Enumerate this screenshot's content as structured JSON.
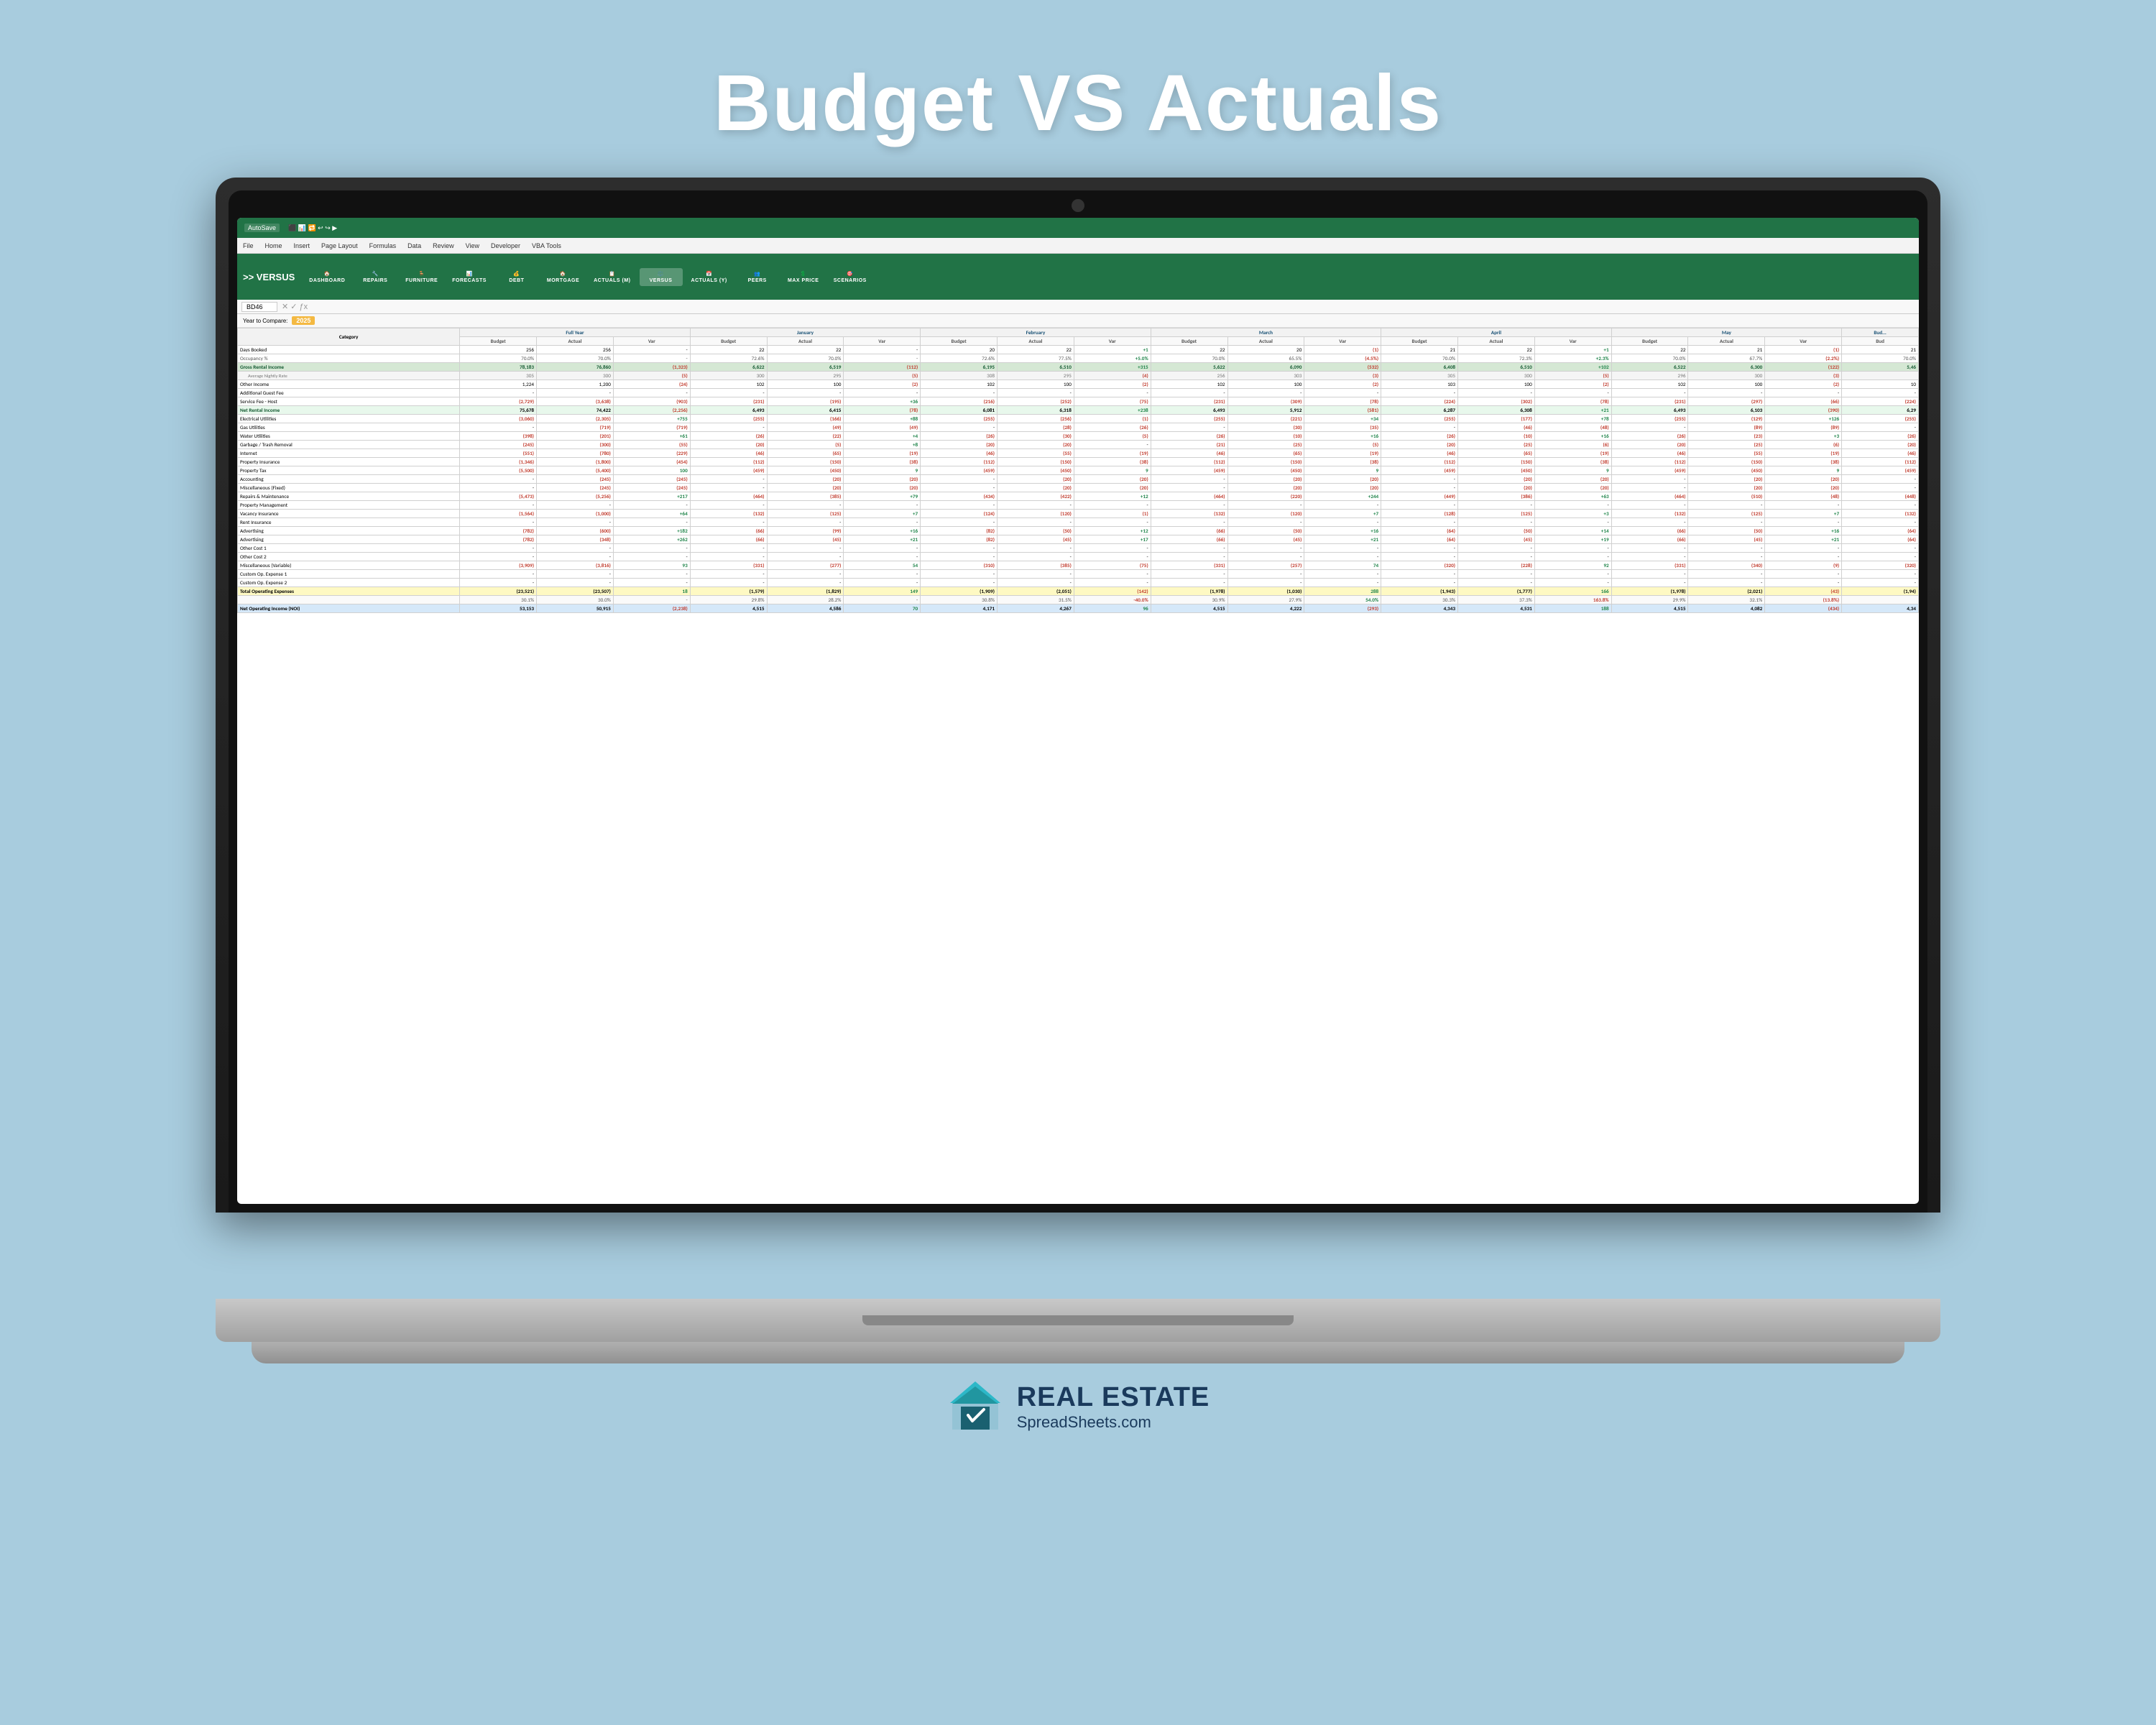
{
  "page": {
    "title": "Budget VS Actuals",
    "background": "#a8ccde"
  },
  "brand": {
    "name": "REAL ESTATE",
    "url": "SpreadSheets.com"
  },
  "excel": {
    "autosave": "AutoSave",
    "cellRef": "BD46",
    "menuItems": [
      "File",
      "Home",
      "Insert",
      "Page Layout",
      "Formulas",
      "Data",
      "Review",
      "View",
      "Developer",
      "VBA Tools"
    ],
    "ribbonButtons": [
      {
        "icon": "🏠",
        "label": "DASHBOARD"
      },
      {
        "icon": "🔧",
        "label": "REPAIRS"
      },
      {
        "icon": "🪑",
        "label": "FURNITURE"
      },
      {
        "icon": "📊",
        "label": "FORECASTS"
      },
      {
        "icon": "💰",
        "label": "DEBT"
      },
      {
        "icon": "🏠",
        "label": "MORTGAGE"
      },
      {
        "icon": "📋",
        "label": "ACTUALS (M)"
      },
      {
        "icon": "⚖️",
        "label": "VERSUS"
      },
      {
        "icon": "📅",
        "label": "ACTUALS (Y)"
      },
      {
        "icon": "👥",
        "label": "PEERS"
      },
      {
        "icon": "💲",
        "label": "MAX PRICE"
      },
      {
        "icon": "🎯",
        "label": "SCENARIOS"
      }
    ],
    "versusLabel": ">> VERSUS",
    "yearCompare": "Year to Compare:",
    "yearTag": "2025"
  },
  "table": {
    "months": [
      "Full Year",
      "January",
      "February",
      "March",
      "April",
      "May"
    ],
    "subHeaders": [
      "Budget",
      "Actual",
      "Var"
    ],
    "rows": [
      {
        "category": "Days Booked",
        "type": "data",
        "values": [
          "256",
          "256",
          "-",
          "22",
          "22",
          "-",
          "20",
          "22",
          "+1",
          "22",
          "20",
          "(1)",
          "21",
          "22",
          "+1",
          "22",
          "21",
          "(1)"
        ]
      },
      {
        "category": "Occupancy %",
        "type": "pct",
        "values": [
          "70.0%",
          "70.0%",
          "-",
          "72.6%",
          "70.0%",
          "-",
          "72.6%",
          "77.5%",
          "+5.0%",
          "70.0%",
          "65.5%",
          "(4.5%)",
          "70.0%",
          "72.3%",
          "+2.3%",
          "70.0%",
          "67.7%",
          "(2.2%)"
        ]
      },
      {
        "category": "Gross Rental Income",
        "type": "section-header",
        "values": [
          "78,183",
          "76,860",
          "(1,323)",
          "6,622",
          "6,519",
          "(112)",
          "6,195",
          "6,510",
          "+315",
          "5,622",
          "6,090",
          "(532)",
          "6,408",
          "6,510",
          "+102",
          "6,522",
          "6,300",
          "(122)"
        ]
      },
      {
        "category": "Average Nightly Rate",
        "type": "rate",
        "values": [
          "305",
          "300",
          "(5)",
          "300",
          "295",
          "(5)",
          "308",
          "295",
          "(4)",
          "256",
          "303",
          "(3)",
          "305",
          "300",
          "(5)",
          "296",
          "300",
          "(3)"
        ]
      },
      {
        "category": "Other Income",
        "type": "data",
        "values": [
          "1,224",
          "1,200",
          "(24)",
          "102",
          "100",
          "(2)",
          "102",
          "100",
          "(2)",
          "102",
          "100",
          "(2)",
          "103",
          "100",
          "(2)",
          "102",
          "100",
          "(2)"
        ]
      },
      {
        "category": "Additional Guest Fee",
        "type": "data",
        "values": [
          "-",
          "-",
          "-",
          "-",
          "-",
          "-",
          "-",
          "-",
          "-",
          "-",
          "-",
          "-",
          "-",
          "-",
          "-",
          "-",
          "-",
          "-"
        ]
      },
      {
        "category": "Service Fee - Host",
        "type": "data",
        "values": [
          "(2,729)",
          "(3,638)",
          "(903)",
          "(231)",
          "(195)",
          "+36",
          "(216)",
          "(252)",
          "(75)",
          "(231)",
          "(309)",
          "(78)",
          "(224)",
          "(302)",
          "(78)",
          "(231)",
          "(297)",
          "(66)"
        ]
      },
      {
        "category": "Net Rental Income",
        "type": "bold-green",
        "values": [
          "75,678",
          "74,422",
          "(2,256)",
          "6,493",
          "6,415",
          "(78)",
          "6,081",
          "6,318",
          "+238",
          "6,493",
          "5,912",
          "(581)",
          "6,287",
          "6,308",
          "+21",
          "6,493",
          "6,103",
          "(390)"
        ]
      },
      {
        "category": "Electrical Utilities",
        "type": "data",
        "values": [
          "(3,060)",
          "(2,305)",
          "+755",
          "(255)",
          "(166)",
          "+88",
          "(255)",
          "(256)",
          "(1)",
          "(255)",
          "(221)",
          "+34",
          "(255)",
          "(177)",
          "+78",
          "(255)",
          "(129)",
          "+126"
        ]
      },
      {
        "category": "Gas Utilities",
        "type": "data",
        "values": [
          "-",
          "(719)",
          "(719)",
          "(49)",
          "(49)",
          "(28)",
          "(26)",
          "(30)",
          "(35)",
          "(46)",
          "(48)",
          "(89)",
          "(89)"
        ]
      },
      {
        "category": "Water Utilities",
        "type": "data",
        "values": [
          "(398)",
          "(201)",
          "+61",
          "(26)",
          "(22)",
          "+4",
          "(26)",
          "(30)",
          "(5)",
          "(26)",
          "(10)",
          "+16",
          "(26)",
          "(10)",
          "+16",
          "(26)",
          "(23)",
          "+3"
        ]
      },
      {
        "category": "Garbage / Trash Removal",
        "type": "data",
        "values": [
          "(245)",
          "(300)",
          "(55)",
          "(20)",
          "(5)",
          "+8",
          "(20)",
          "(20)",
          "(21)",
          "(25)",
          "(5)",
          "(20)",
          "(25)",
          "(6)",
          "(20)",
          "(25)",
          "(6)"
        ]
      },
      {
        "category": "Internet",
        "type": "data",
        "values": [
          "(551)",
          "(780)",
          "(229)",
          "(46)",
          "(65)",
          "(19)",
          "(46)",
          "(55)",
          "(19)",
          "(46)",
          "(65)",
          "(19)",
          "(46)",
          "(65)",
          "(19)",
          "(46)",
          "(55)",
          "(19)"
        ]
      },
      {
        "category": "Property Insurance",
        "type": "data",
        "values": [
          "(1,346)",
          "(1,800)",
          "(454)",
          "(112)",
          "(150)",
          "(38)",
          "(112)",
          "(150)",
          "(38)",
          "(112)",
          "(150)",
          "(38)",
          "(112)",
          "(150)",
          "(38)",
          "(112)",
          "(150)",
          "(38)"
        ]
      },
      {
        "category": "Property Tax",
        "type": "data",
        "values": [
          "(5,500)",
          "(5,400)",
          "100",
          "(459)",
          "(450)",
          "9",
          "(459)",
          "(450)",
          "9",
          "(459)",
          "(450)",
          "9",
          "(459)",
          "(450)",
          "9",
          "(459)",
          "(450)",
          "9"
        ]
      },
      {
        "category": "Accounting",
        "type": "data",
        "values": [
          "-",
          "(245)",
          "(245)",
          "(20)",
          "(20)",
          "(20)",
          "(20)",
          "(20)",
          "(20)",
          "(20)",
          "(20)",
          "(20)",
          "(20)",
          "(20)",
          "(20)"
        ]
      },
      {
        "category": "Miscellaneous (Fixed)",
        "type": "data",
        "values": [
          "-",
          "(245)",
          "(245)",
          "(20)",
          "(20)",
          "(20)",
          "(20)",
          "(20)",
          "(20)",
          "(20)",
          "(20)",
          "(20)",
          "(20)",
          "(20)"
        ]
      },
      {
        "category": "Repairs & Maintenance",
        "type": "data",
        "values": [
          "(5,473)",
          "(5,256)",
          "+217",
          "(464)",
          "(385)",
          "+79",
          "(434)",
          "(422)",
          "(464)",
          "(220)",
          "+244",
          "(449)",
          "(386)",
          "(464)",
          "(510)",
          "(48)"
        ]
      },
      {
        "category": "Property Management",
        "type": "data",
        "values": [
          "-",
          "-",
          "-",
          "-",
          "-",
          "-",
          "-",
          "-",
          "-",
          "-",
          "-",
          "-",
          "-",
          "-",
          "-",
          "-",
          "-",
          "-"
        ]
      },
      {
        "category": "Vacancy Insurance",
        "type": "data",
        "values": [
          "(1,564)",
          "(1,000)",
          "+64",
          "(132)",
          "(125)",
          "+7",
          "(124)",
          "(120)",
          "(1)",
          "(132)",
          "(120)",
          "+7",
          "(128)",
          "(125)",
          "+3",
          "(132)",
          "(125)",
          "+7"
        ]
      },
      {
        "category": "Rent Insurance",
        "type": "data",
        "values": [
          "-",
          "-",
          "-",
          "-",
          "-",
          "-",
          "-",
          "-",
          "-",
          "-",
          "-",
          "-",
          "-",
          "-",
          "-",
          "-",
          "-",
          "-"
        ]
      },
      {
        "category": "Advertising",
        "type": "data",
        "values": [
          "(782)",
          "(600)",
          "+182",
          "(66)",
          "(99)",
          "+16",
          "(82)",
          "(50)",
          "(66)",
          "(50)",
          "+16",
          "(64)",
          "(50)",
          "(66)",
          "(50)"
        ]
      },
      {
        "category": "Advertising",
        "type": "data2",
        "values": [
          "(782)",
          "(348)",
          "+262",
          "(66)",
          "(45)",
          "+21",
          "(82)",
          "(45)",
          "(66)",
          "(45)",
          "+21",
          "(64)",
          "(45)",
          "(66)",
          "(45)"
        ]
      },
      {
        "category": "Other Cost 1",
        "type": "data",
        "values": [
          "-",
          "-",
          "-",
          "-",
          "-",
          "-",
          "-",
          "-",
          "-",
          "-",
          "-",
          "-",
          "-",
          "-",
          "-",
          "-",
          "-",
          "-"
        ]
      },
      {
        "category": "Other Cost 2",
        "type": "data",
        "values": [
          "-",
          "-",
          "-",
          "-",
          "-",
          "-",
          "-",
          "-",
          "-",
          "-",
          "-",
          "-",
          "-",
          "-",
          "-",
          "-",
          "-",
          "-"
        ]
      },
      {
        "category": "Miscellaneous (Variable)",
        "type": "data",
        "values": [
          "(3,909)",
          "(3,816)",
          "93",
          "(331)",
          "(277)",
          "54",
          "(310)",
          "(385)",
          "(75)",
          "(331)",
          "(257)",
          "74",
          "(320)",
          "(228)",
          "92",
          "(331)",
          "(340)",
          "(9)"
        ]
      },
      {
        "category": "Custom Op. Expense 1",
        "type": "data",
        "values": [
          "-",
          "-",
          "-",
          "-",
          "-",
          "-",
          "-",
          "-",
          "-",
          "-",
          "-",
          "-",
          "-",
          "-",
          "-",
          "-",
          "-",
          "-"
        ]
      },
      {
        "category": "Custom Op. Expense 2",
        "type": "data",
        "values": [
          "-",
          "-",
          "-",
          "-",
          "-",
          "-",
          "-",
          "-",
          "-",
          "-",
          "-",
          "-",
          "-",
          "-",
          "-",
          "-",
          "-",
          "-"
        ]
      },
      {
        "category": "Total Operating Expenses",
        "type": "totals",
        "values": [
          "(23,521)",
          "(23,507)",
          "18",
          "(1,579)",
          "(1,829)",
          "149",
          "(1,909)",
          "(2,051)",
          "(142)",
          "(1,978)",
          "(1,030)",
          "288",
          "(1,943)",
          "(1,777)",
          "166",
          "(1,978)",
          "(2,021)",
          "(43)"
        ]
      },
      {
        "category": "pct1",
        "type": "pct-row",
        "values": [
          "30.1%",
          "30.0%",
          "-",
          "29.8%",
          "28.2%",
          "-",
          "30.8%",
          "31.5%",
          "-40.0%",
          "30.9%",
          "27.9%",
          "54.0%",
          "30.3%",
          "37.3%",
          "163.8%",
          "29.9%",
          "32.1%",
          "(13.8%)"
        ]
      },
      {
        "category": "Net Operating Income (NOI)",
        "type": "noi",
        "values": [
          "53,153",
          "50,915",
          "(2,238)",
          "4,515",
          "4,586",
          "70",
          "4,171",
          "4,267",
          "96",
          "4,515",
          "4,222",
          "(293)",
          "4,343",
          "4,531",
          "188",
          "4,515",
          "4,082",
          "(434)"
        ]
      }
    ]
  }
}
